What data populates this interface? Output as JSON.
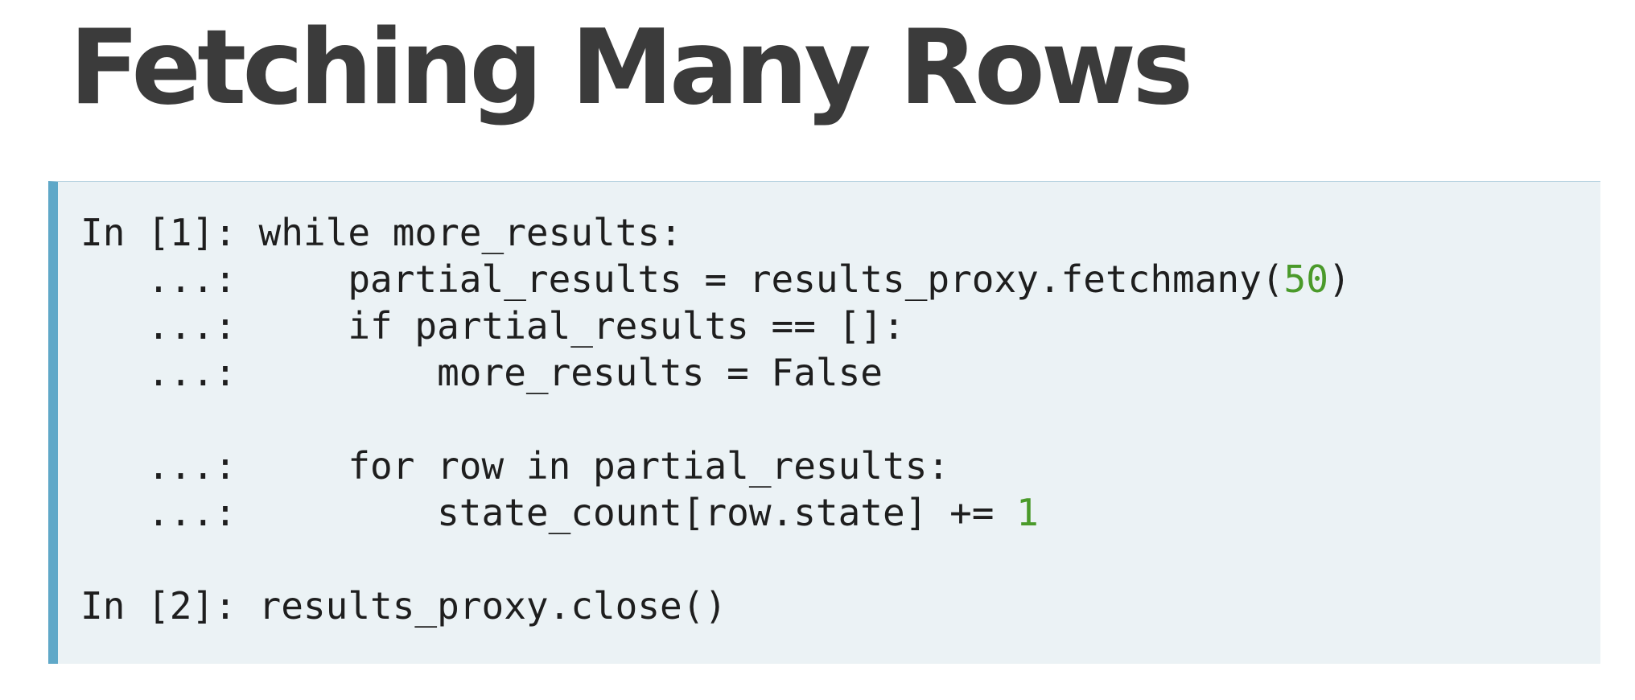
{
  "title": "Fetching Many Rows",
  "code": {
    "line1": "In [1]: while more_results:",
    "line2_pre": "   ...:     partial_results = results_proxy.fetchmany(",
    "line2_num": "50",
    "line2_post": ")",
    "line3": "   ...:     if partial_results == []:",
    "line4": "   ...:         more_results = False",
    "line5": "",
    "line6": "   ...:     for row in partial_results:",
    "line7_pre": "   ...:         state_count[row.state] += ",
    "line7_num": "1",
    "line8": "",
    "line9": "In [2]: results_proxy.close()"
  },
  "colors": {
    "title": "#3b3b3b",
    "code_background": "#ebf2f5",
    "code_border": "#5fa8c8",
    "number_literal": "#4a9a2a"
  }
}
